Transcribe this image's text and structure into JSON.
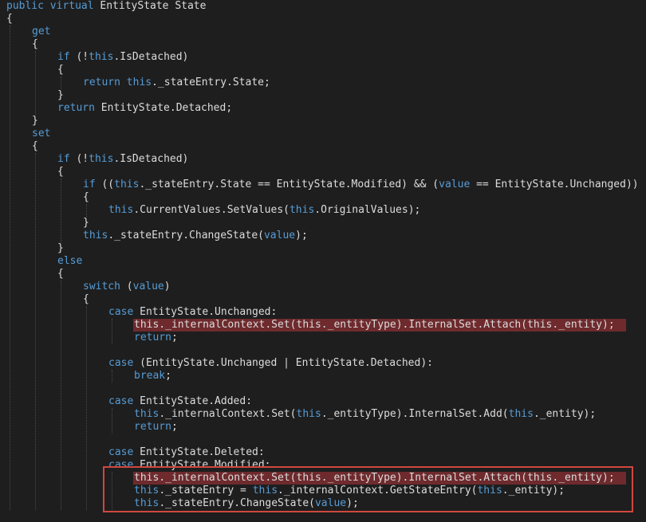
{
  "editor": {
    "theme_colors": {
      "background": "#1e1e1e",
      "text": "#dcdcdc",
      "keyword": "#569cd6",
      "breakpoint_highlight": "#6e2a2d",
      "annotation_box": "#d0473e"
    },
    "lines": [
      {
        "indent": 0,
        "tokens": [
          {
            "k": true,
            "t": "public virtual"
          },
          {
            "k": false,
            "t": " EntityState State"
          }
        ]
      },
      {
        "indent": 0,
        "tokens": [
          {
            "k": false,
            "t": "{"
          }
        ]
      },
      {
        "indent": 1,
        "tokens": [
          {
            "k": true,
            "t": "get"
          }
        ]
      },
      {
        "indent": 1,
        "tokens": [
          {
            "k": false,
            "t": "{"
          }
        ]
      },
      {
        "indent": 2,
        "tokens": [
          {
            "k": true,
            "t": "if"
          },
          {
            "k": false,
            "t": " (!"
          },
          {
            "k": true,
            "t": "this"
          },
          {
            "k": false,
            "t": ".IsDetached)"
          }
        ]
      },
      {
        "indent": 2,
        "tokens": [
          {
            "k": false,
            "t": "{"
          }
        ]
      },
      {
        "indent": 3,
        "tokens": [
          {
            "k": true,
            "t": "return"
          },
          {
            "k": false,
            "t": " "
          },
          {
            "k": true,
            "t": "this"
          },
          {
            "k": false,
            "t": "._stateEntry.State;"
          }
        ]
      },
      {
        "indent": 2,
        "tokens": [
          {
            "k": false,
            "t": "}"
          }
        ]
      },
      {
        "indent": 2,
        "tokens": [
          {
            "k": true,
            "t": "return"
          },
          {
            "k": false,
            "t": " EntityState.Detached;"
          }
        ]
      },
      {
        "indent": 1,
        "tokens": [
          {
            "k": false,
            "t": "}"
          }
        ]
      },
      {
        "indent": 1,
        "tokens": [
          {
            "k": true,
            "t": "set"
          }
        ]
      },
      {
        "indent": 1,
        "tokens": [
          {
            "k": false,
            "t": "{"
          }
        ]
      },
      {
        "indent": 2,
        "tokens": [
          {
            "k": true,
            "t": "if"
          },
          {
            "k": false,
            "t": " (!"
          },
          {
            "k": true,
            "t": "this"
          },
          {
            "k": false,
            "t": ".IsDetached)"
          }
        ]
      },
      {
        "indent": 2,
        "tokens": [
          {
            "k": false,
            "t": "{"
          }
        ]
      },
      {
        "indent": 3,
        "tokens": [
          {
            "k": true,
            "t": "if"
          },
          {
            "k": false,
            "t": " (("
          },
          {
            "k": true,
            "t": "this"
          },
          {
            "k": false,
            "t": "._stateEntry.State == EntityState.Modified) && ("
          },
          {
            "k": true,
            "t": "value"
          },
          {
            "k": false,
            "t": " == EntityState.Unchanged))"
          }
        ]
      },
      {
        "indent": 3,
        "tokens": [
          {
            "k": false,
            "t": "{"
          }
        ]
      },
      {
        "indent": 4,
        "tokens": [
          {
            "k": true,
            "t": "this"
          },
          {
            "k": false,
            "t": ".CurrentValues.SetValues("
          },
          {
            "k": true,
            "t": "this"
          },
          {
            "k": false,
            "t": ".OriginalValues);"
          }
        ]
      },
      {
        "indent": 3,
        "tokens": [
          {
            "k": false,
            "t": "}"
          }
        ]
      },
      {
        "indent": 3,
        "tokens": [
          {
            "k": true,
            "t": "this"
          },
          {
            "k": false,
            "t": "._stateEntry.ChangeState("
          },
          {
            "k": true,
            "t": "value"
          },
          {
            "k": false,
            "t": ");"
          }
        ]
      },
      {
        "indent": 2,
        "tokens": [
          {
            "k": false,
            "t": "}"
          }
        ]
      },
      {
        "indent": 2,
        "tokens": [
          {
            "k": true,
            "t": "else"
          }
        ]
      },
      {
        "indent": 2,
        "tokens": [
          {
            "k": false,
            "t": "{"
          }
        ]
      },
      {
        "indent": 3,
        "tokens": [
          {
            "k": true,
            "t": "switch"
          },
          {
            "k": false,
            "t": " ("
          },
          {
            "k": true,
            "t": "value"
          },
          {
            "k": false,
            "t": ")"
          }
        ]
      },
      {
        "indent": 3,
        "tokens": [
          {
            "k": false,
            "t": "{"
          }
        ]
      },
      {
        "indent": 4,
        "tokens": [
          {
            "k": true,
            "t": "case"
          },
          {
            "k": false,
            "t": " EntityState.Unchanged:"
          }
        ]
      },
      {
        "indent": 5,
        "hl": true,
        "tokens": [
          {
            "k": false,
            "t": "this._internalContext.Set(this._entityType).InternalSet.Attach(this._entity);"
          }
        ]
      },
      {
        "indent": 5,
        "tokens": [
          {
            "k": true,
            "t": "return"
          },
          {
            "k": false,
            "t": ";"
          }
        ]
      },
      {
        "indent": 0,
        "tokens": []
      },
      {
        "indent": 4,
        "tokens": [
          {
            "k": true,
            "t": "case"
          },
          {
            "k": false,
            "t": " (EntityState.Unchanged | EntityState.Detached):"
          }
        ]
      },
      {
        "indent": 5,
        "tokens": [
          {
            "k": true,
            "t": "break"
          },
          {
            "k": false,
            "t": ";"
          }
        ]
      },
      {
        "indent": 0,
        "tokens": []
      },
      {
        "indent": 4,
        "tokens": [
          {
            "k": true,
            "t": "case"
          },
          {
            "k": false,
            "t": " EntityState.Added:"
          }
        ]
      },
      {
        "indent": 5,
        "tokens": [
          {
            "k": true,
            "t": "this"
          },
          {
            "k": false,
            "t": "._internalContext.Set("
          },
          {
            "k": true,
            "t": "this"
          },
          {
            "k": false,
            "t": "._entityType).InternalSet.Add("
          },
          {
            "k": true,
            "t": "this"
          },
          {
            "k": false,
            "t": "._entity);"
          }
        ]
      },
      {
        "indent": 5,
        "tokens": [
          {
            "k": true,
            "t": "return"
          },
          {
            "k": false,
            "t": ";"
          }
        ]
      },
      {
        "indent": 0,
        "tokens": []
      },
      {
        "indent": 4,
        "tokens": [
          {
            "k": true,
            "t": "case"
          },
          {
            "k": false,
            "t": " EntityState.Deleted:"
          }
        ]
      },
      {
        "indent": 4,
        "tokens": [
          {
            "k": true,
            "t": "case"
          },
          {
            "k": false,
            "t": " EntityState.Modified:"
          }
        ]
      },
      {
        "indent": 5,
        "hl": true,
        "tokens": [
          {
            "k": false,
            "t": "this._internalContext.Set(this._entityType).InternalSet.Attach(this._entity);"
          }
        ]
      },
      {
        "indent": 5,
        "tokens": [
          {
            "k": true,
            "t": "this"
          },
          {
            "k": false,
            "t": "._stateEntry = "
          },
          {
            "k": true,
            "t": "this"
          },
          {
            "k": false,
            "t": "._internalContext.GetStateEntry("
          },
          {
            "k": true,
            "t": "this"
          },
          {
            "k": false,
            "t": "._entity);"
          }
        ]
      },
      {
        "indent": 5,
        "tokens": [
          {
            "k": true,
            "t": "this"
          },
          {
            "k": false,
            "t": "._stateEntry.ChangeState("
          },
          {
            "k": true,
            "t": "value"
          },
          {
            "k": false,
            "t": ");"
          }
        ]
      }
    ]
  }
}
